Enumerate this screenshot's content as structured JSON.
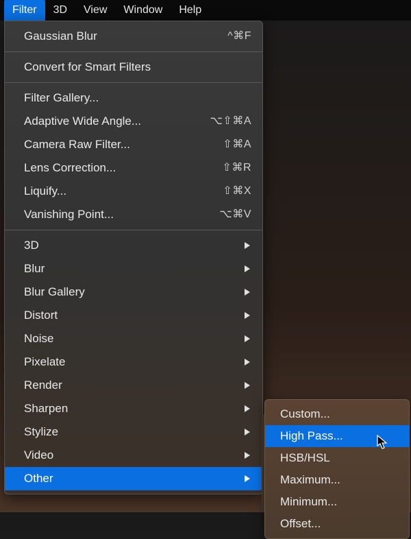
{
  "menubar": {
    "items": [
      {
        "label": "Filter",
        "active": true
      },
      {
        "label": "3D"
      },
      {
        "label": "View"
      },
      {
        "label": "Window"
      },
      {
        "label": "Help"
      }
    ]
  },
  "dropdown": {
    "groups": [
      [
        {
          "label": "Gaussian Blur",
          "shortcut": "^⌘F"
        }
      ],
      [
        {
          "label": "Convert for Smart Filters"
        }
      ],
      [
        {
          "label": "Filter Gallery..."
        },
        {
          "label": "Adaptive Wide Angle...",
          "shortcut": "⌥⇧⌘A"
        },
        {
          "label": "Camera Raw Filter...",
          "shortcut": "⇧⌘A"
        },
        {
          "label": "Lens Correction...",
          "shortcut": "⇧⌘R"
        },
        {
          "label": "Liquify...",
          "shortcut": "⇧⌘X"
        },
        {
          "label": "Vanishing Point...",
          "shortcut": "⌥⌘V"
        }
      ],
      [
        {
          "label": "3D",
          "submenu": true
        },
        {
          "label": "Blur",
          "submenu": true
        },
        {
          "label": "Blur Gallery",
          "submenu": true
        },
        {
          "label": "Distort",
          "submenu": true
        },
        {
          "label": "Noise",
          "submenu": true
        },
        {
          "label": "Pixelate",
          "submenu": true
        },
        {
          "label": "Render",
          "submenu": true
        },
        {
          "label": "Sharpen",
          "submenu": true
        },
        {
          "label": "Stylize",
          "submenu": true
        },
        {
          "label": "Video",
          "submenu": true
        },
        {
          "label": "Other",
          "submenu": true,
          "highlight": true
        }
      ]
    ]
  },
  "submenu": {
    "items": [
      {
        "label": "Custom..."
      },
      {
        "label": "High Pass...",
        "highlight": true
      },
      {
        "label": "HSB/HSL"
      },
      {
        "label": "Maximum..."
      },
      {
        "label": "Minimum..."
      },
      {
        "label": "Offset..."
      }
    ]
  }
}
